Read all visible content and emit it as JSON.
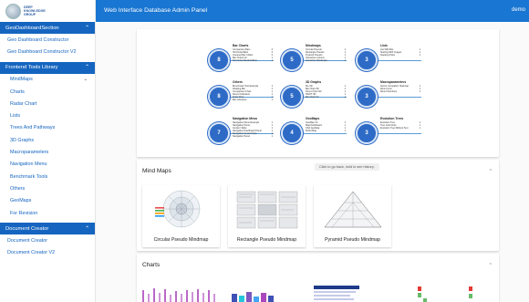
{
  "app": {
    "title": "Web Interface Database Admin Panel",
    "user": "demo",
    "logo_text": [
      "DEEP",
      "KNOWLEDGE",
      "GROUP"
    ]
  },
  "sidebar": {
    "sections": [
      {
        "label": "GeoDashboardSection",
        "items": [
          "Geo Dashboard Constructor",
          "Geo Dashboard Constructor V2"
        ]
      },
      {
        "label": "Frontend Tools Library",
        "items": [
          "MindMaps",
          "Charts",
          "Radar Chart",
          "Lists",
          "Trees And Pathways",
          "3D Graphs",
          "Macroparameters",
          "Navigation Menu",
          "Benchmark Tools",
          "Others",
          "GeoMaps",
          "For Revision"
        ]
      },
      {
        "label": "Document Creator",
        "items": [
          "Document Creator",
          "Document Creator V2"
        ]
      }
    ]
  },
  "overview": {
    "groups": [
      {
        "title": "Bar Charts",
        "count": "8",
        "items": [
          [
            "Comparison Bars",
            "3"
          ],
          [
            "Horizontal Bars",
            "4"
          ],
          [
            "Grouped Bar Charts",
            "2"
          ],
          [
            "Bar Charts V2",
            "1"
          ],
          [
            "Horizontal Stacked Bars",
            "1"
          ]
        ]
      },
      {
        "title": "Mindmaps",
        "count": "5",
        "items": [
          [
            "Circular Pseudo",
            "1"
          ],
          [
            "Rectangle Pseudo",
            "1"
          ],
          [
            "Pyramid Pseudo",
            "1"
          ],
          [
            "Interactive Column",
            "1"
          ],
          [
            "Interactive Mindmaps",
            "1"
          ]
        ]
      },
      {
        "title": "Lists",
        "count": "3",
        "items": [
          [
            "List With Bar",
            "1"
          ],
          [
            "Starting With Images",
            "1"
          ],
          [
            "Stacking Pairs",
            "1"
          ]
        ]
      },
      {
        "title": "Others",
        "count": "8",
        "items": [
          [
            "Benchmark Tool Example",
            "1"
          ],
          [
            "Rotating Bar",
            "1"
          ],
          [
            "Comparison Chart",
            "1"
          ],
          [
            "Round Indicators",
            "1"
          ],
          [
            "Scale Flow",
            "1"
          ],
          [
            "Bar Indicators",
            "1"
          ]
        ]
      },
      {
        "title": "3D Graphs",
        "count": "5",
        "items": [
          [
            "Pie 3D",
            "1"
          ],
          [
            "Bar Chart 3D",
            "1"
          ],
          [
            "Donut Chart 3D",
            "1"
          ],
          [
            "SWOT 3D",
            "1"
          ],
          [
            "Bar Chart V2",
            "1"
          ]
        ]
      },
      {
        "title": "Macroparameters",
        "count": "3",
        "items": [
          [
            "Sector Correlation Heatmap",
            "1"
          ],
          [
            "Round Icon",
            "1"
          ],
          [
            "Round Numbers",
            "1"
          ]
        ]
      },
      {
        "title": "Navigation Menu",
        "count": "7",
        "items": [
          [
            "Navigation Menu Example",
            "1"
          ],
          [
            "Navigation Panel",
            "1"
          ],
          [
            "Content Table",
            "1"
          ],
          [
            "Navigation Dashboard Panel",
            "1"
          ],
          [
            "Navigation Nested Style",
            "1"
          ],
          [
            "Navigation Panel",
            "1"
          ]
        ]
      },
      {
        "title": "GeoMaps",
        "count": "4",
        "items": [
          [
            "GeoMap V2",
            "1"
          ],
          [
            "Map Dashboard",
            "1"
          ],
          [
            "USA GeoMap",
            "1"
          ],
          [
            "World Map",
            "1"
          ]
        ]
      },
      {
        "title": "Evolution Trees",
        "count": "3",
        "items": [
          [
            "Evolution Tree",
            "1"
          ],
          [
            "Tree Color Dots",
            "1"
          ],
          [
            "Evolution Tree Without Text",
            "1"
          ]
        ]
      }
    ]
  },
  "mindmaps": {
    "title": "Mind Maps",
    "tooltip": "Click to go back, hold to see history.",
    "cards": [
      "Circular Pseudo Mindmap",
      "Rectangle Pseudo Mindmap",
      "Pyramid Pseudo Mindmap"
    ]
  },
  "charts": {
    "title": "Charts"
  }
}
